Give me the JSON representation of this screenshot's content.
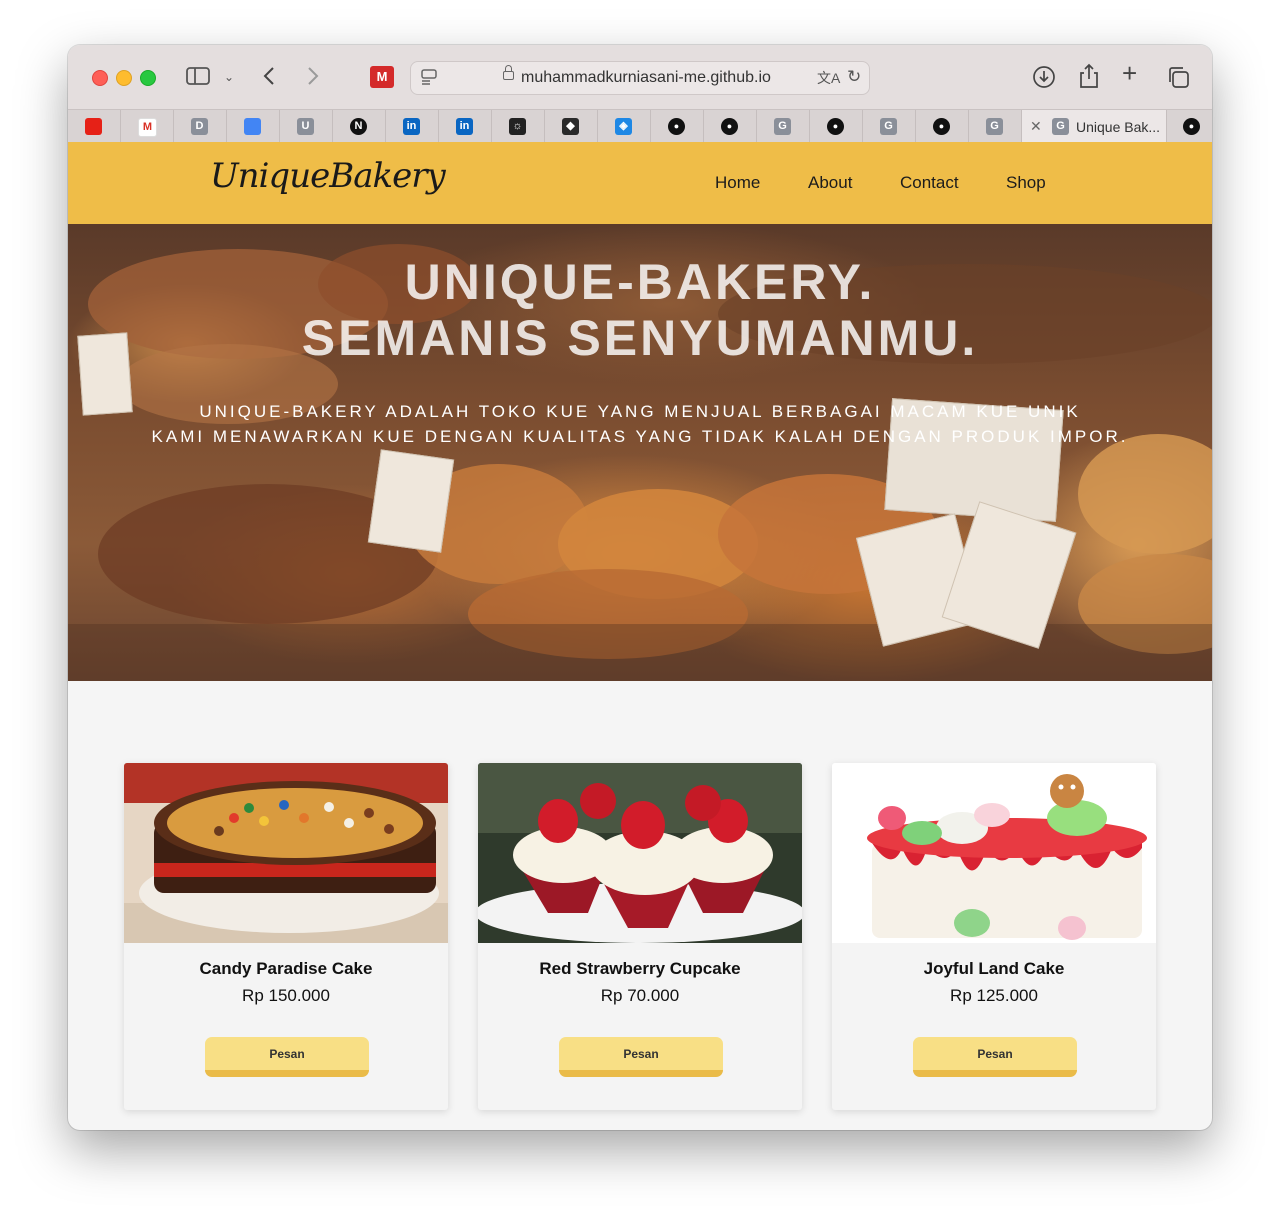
{
  "browser": {
    "url": "muhammadkurniasani-me.github.io",
    "active_tab_title": "Unique Bak...",
    "tabs": [
      {
        "icon": "youtube-icon",
        "letter": "",
        "color": "#e62117"
      },
      {
        "icon": "gmail-icon",
        "letter": "M",
        "color": "#ffffff"
      },
      {
        "icon": "d-icon",
        "letter": "D",
        "color": "#8a8f99"
      },
      {
        "icon": "docs-icon",
        "letter": "",
        "color": "#4285f4"
      },
      {
        "icon": "u-icon",
        "letter": "U",
        "color": "#8a8f99"
      },
      {
        "icon": "n-icon",
        "letter": "N",
        "color": "#111111"
      },
      {
        "icon": "linkedin-icon",
        "letter": "in",
        "color": "#0a66c2"
      },
      {
        "icon": "linkedin-icon",
        "letter": "in",
        "color": "#0a66c2"
      },
      {
        "icon": "sun-icon",
        "letter": "☼",
        "color": "#222222"
      },
      {
        "icon": "diamond-icon",
        "letter": "◆",
        "color": "#2a2a2a"
      },
      {
        "icon": "box-icon",
        "letter": "◈",
        "color": "#1e88e5"
      },
      {
        "icon": "github-icon",
        "letter": "●",
        "color": "#111111"
      },
      {
        "icon": "github-icon",
        "letter": "●",
        "color": "#111111"
      },
      {
        "icon": "g-icon",
        "letter": "G",
        "color": "#8a8f99"
      },
      {
        "icon": "github-icon",
        "letter": "●",
        "color": "#111111"
      },
      {
        "icon": "g-icon",
        "letter": "G",
        "color": "#8a8f99"
      },
      {
        "icon": "github-icon",
        "letter": "●",
        "color": "#111111"
      },
      {
        "icon": "g-icon",
        "letter": "G",
        "color": "#8a8f99"
      }
    ]
  },
  "site": {
    "logo": "UniqueBakery",
    "nav": {
      "home": "Home",
      "about": "About",
      "contact": "Contact",
      "shop": "Shop"
    },
    "accent_color": "#efbd48"
  },
  "hero": {
    "title_line1": "UNIQUE-BAKERY.",
    "title_line2": "SEMANIS SENYUMANMU.",
    "desc_line1": "UNIQUE-BAKERY ADALAH TOKO KUE YANG MENJUAL BERBAGAI MACAM KUE UNIK",
    "desc_line2": "KAMI MENAWARKAN KUE DENGAN KUALITAS YANG TIDAK KALAH DENGAN PRODUK IMPOR."
  },
  "products": [
    {
      "name": "Candy Paradise Cake",
      "price": "Rp 150.000",
      "button": "Pesan"
    },
    {
      "name": "Red Strawberry Cupcake",
      "price": "Rp 70.000",
      "button": "Pesan"
    },
    {
      "name": "Joyful Land Cake",
      "price": "Rp 125.000",
      "button": "Pesan"
    }
  ]
}
